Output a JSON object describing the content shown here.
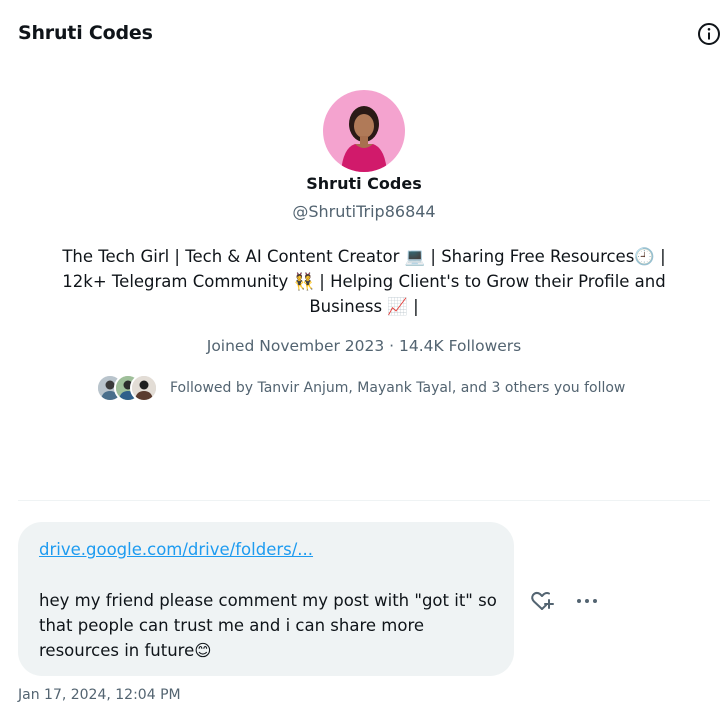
{
  "header": {
    "title": "Shruti Codes",
    "info_icon": "info-icon"
  },
  "profile": {
    "display_name": "Shruti Codes",
    "handle": "@ShrutiTrip86844",
    "bio_line1": "The Tech Girl | Tech & AI Content Creator 💻 | Sharing Free Resources🕘 |",
    "bio_line2": "12k+ Telegram Community 👯 | Helping Client's to Grow their Profile and",
    "bio_line3": "Business 📈 |",
    "joined_followers": "Joined November 2023 · 14.4K Followers",
    "followed_by": "Followed by Tanvir Anjum, Mayank Tayal, and 3 others you follow"
  },
  "message": {
    "link": "drive.google.com/drive/folders/...",
    "text": "hey my friend please comment my post with \"got it\" so that people can trust me and i can share more resources in future😊",
    "timestamp": "Jan 17, 2024, 12:04 PM"
  },
  "colors": {
    "link": "#1d9bf0",
    "bubble": "#eff3f4",
    "secondary_text": "#536471",
    "avatar_bg": "#f4a3cf"
  }
}
